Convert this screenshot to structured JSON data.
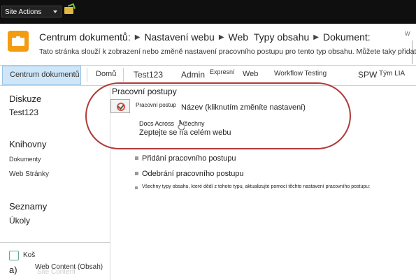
{
  "topbar": {
    "site_actions": "Site Actions"
  },
  "header": {
    "breadcrumb": [
      "Centrum dokumentů:",
      "Nastavení webu",
      "Web",
      "Typy obsahu",
      "Dokument:"
    ],
    "description": "Tato stránka slouží k zobrazení nebo změně nastavení pracovního postupu pro tento typ obsahu. Můžete taky přidat",
    "corner_text": "W"
  },
  "topnav": {
    "items": [
      "Centrum dokumentů",
      "Domů",
      "Test123",
      "Admin",
      "Expresní",
      "Web",
      "Workflow Testing",
      "SPW",
      "Tým LIA"
    ]
  },
  "leftnav": {
    "diskuze": "Diskuze",
    "test123": "Test123",
    "knihovny": "Knihovny",
    "dokumenty": "Dokumenty",
    "web_stranky": "Web Stránky",
    "seznamy": "Seznamy",
    "ukoly": "Úkoly",
    "kos": "Koš",
    "a": "a)",
    "web_content": "Web Content (Obsah)",
    "site_content_ghost": "Site Content"
  },
  "main": {
    "section_title": "Pracovní postupy",
    "col_workflow": "Pracovní postup",
    "col_name": "Název (kliknutím změníte nastavení)",
    "docs_across": "Docs Across",
    "all_label": "Všechny",
    "site_wide": "Zeptejte se na celém webu",
    "add": "Přidání pracovního postupu",
    "remove": "Odebrání pracovního postupu",
    "update": "Všechny typy obsahu, které dědí z tohoto typu, aktualizujte pomocí těchto nastavení pracovního postupu:"
  },
  "colors": {
    "topbar": "#0f0f0f",
    "accent_blue": "#cfe6f8",
    "highlight_red": "#b03a3a",
    "logo_orange": "#f39c12"
  }
}
